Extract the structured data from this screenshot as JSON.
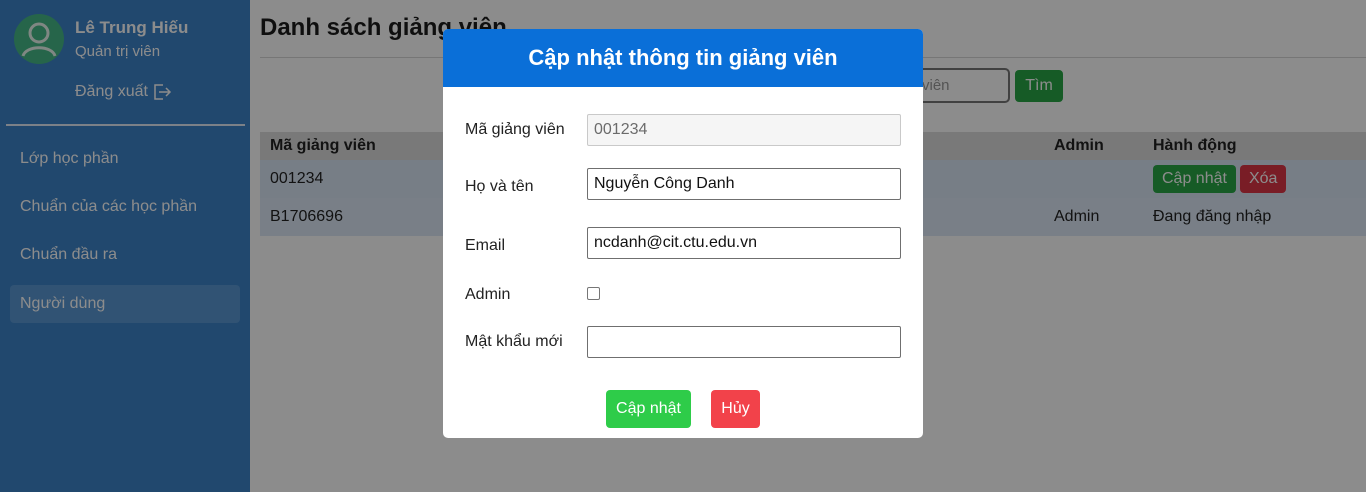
{
  "sidebar": {
    "user_name": "Lê Trung Hiếu",
    "user_role": "Quản trị viên",
    "logout_label": "Đăng xuất",
    "items": [
      {
        "label": "Lớp học phần"
      },
      {
        "label": "Chuẩn của các học phần"
      },
      {
        "label": "Chuẩn đầu ra"
      },
      {
        "label": "Người dùng",
        "active": true
      }
    ]
  },
  "main": {
    "title": "Danh sách giảng viên",
    "search_placeholder": "viên",
    "search_button": "Tìm",
    "table": {
      "headers": [
        "Mã giảng viên",
        "Admin",
        "Hành động"
      ],
      "rows": [
        {
          "id": "001234",
          "admin": "",
          "update_label": "Cập nhật",
          "delete_label": "Xóa"
        },
        {
          "id": "B1706696",
          "admin": "Admin",
          "status": "Đang đăng nhập"
        }
      ]
    }
  },
  "modal": {
    "title": "Cập nhật thông tin giảng viên",
    "fields": {
      "id_label": "Mã giảng viên",
      "id_value": "001234",
      "name_label": "Họ và tên",
      "name_value": "Nguyễn Công Danh",
      "email_label": "Email",
      "email_value": "ncdanh@cit.ctu.edu.vn",
      "admin_label": "Admin",
      "admin_checked": false,
      "password_label": "Mật khẩu mới",
      "password_value": ""
    },
    "save_label": "Cập nhật",
    "cancel_label": "Hủy"
  },
  "colors": {
    "sidebar": "#3c83c9",
    "modal_header": "#0a6fd8",
    "success": "#28a745",
    "danger": "#dc3545"
  }
}
